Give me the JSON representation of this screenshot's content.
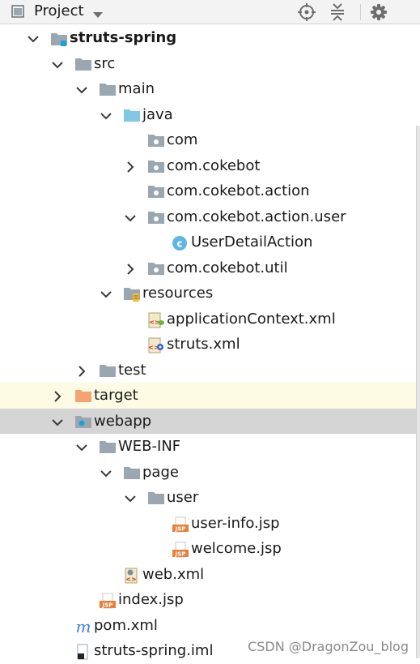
{
  "header": {
    "title": "Project",
    "icons": [
      "project-view-icon",
      "chevron-down-icon",
      "locate-icon",
      "collapse-all-icon",
      "gear-icon"
    ]
  },
  "tree": [
    {
      "label": "struts-spring",
      "depth": 0,
      "expanded": true,
      "icon": "module-folder-icon",
      "bold": true
    },
    {
      "label": "src",
      "depth": 1,
      "expanded": true,
      "icon": "folder-icon"
    },
    {
      "label": "main",
      "depth": 2,
      "expanded": true,
      "icon": "folder-icon"
    },
    {
      "label": "java",
      "depth": 3,
      "expanded": true,
      "icon": "source-root-folder-icon"
    },
    {
      "label": "com",
      "depth": 4,
      "icon": "package-icon"
    },
    {
      "label": "com.cokebot",
      "depth": 4,
      "expanded": false,
      "icon": "package-icon"
    },
    {
      "label": "com.cokebot.action",
      "depth": 4,
      "icon": "package-icon"
    },
    {
      "label": "com.cokebot.action.user",
      "depth": 4,
      "expanded": true,
      "icon": "package-icon"
    },
    {
      "label": "UserDetailAction",
      "depth": 5,
      "icon": "java-class-icon"
    },
    {
      "label": "com.cokebot.util",
      "depth": 4,
      "expanded": false,
      "icon": "package-icon"
    },
    {
      "label": "resources",
      "depth": 3,
      "expanded": true,
      "icon": "resources-folder-icon"
    },
    {
      "label": "applicationContext.xml",
      "depth": 4,
      "icon": "spring-xml-icon"
    },
    {
      "label": "struts.xml",
      "depth": 4,
      "icon": "struts-xml-icon"
    },
    {
      "label": "test",
      "depth": 2,
      "expanded": false,
      "icon": "folder-icon"
    },
    {
      "label": "target",
      "depth": 1,
      "expanded": false,
      "icon": "excluded-folder-icon",
      "highlight": "yellow"
    },
    {
      "label": "webapp",
      "depth": 1,
      "expanded": true,
      "icon": "web-folder-icon",
      "highlight": "grey"
    },
    {
      "label": "WEB-INF",
      "depth": 2,
      "expanded": true,
      "icon": "folder-icon"
    },
    {
      "label": "page",
      "depth": 3,
      "expanded": true,
      "icon": "folder-icon"
    },
    {
      "label": "user",
      "depth": 4,
      "expanded": true,
      "icon": "folder-icon"
    },
    {
      "label": "user-info.jsp",
      "depth": 5,
      "icon": "jsp-file-icon"
    },
    {
      "label": "welcome.jsp",
      "depth": 5,
      "icon": "jsp-file-icon"
    },
    {
      "label": "web.xml",
      "depth": 3,
      "icon": "web-xml-icon"
    },
    {
      "label": "index.jsp",
      "depth": 2,
      "icon": "jsp-file-icon"
    },
    {
      "label": "pom.xml",
      "depth": 1,
      "icon": "maven-icon"
    },
    {
      "label": "struts-spring.iml",
      "depth": 1,
      "icon": "iml-file-icon"
    }
  ],
  "watermark": "CSDN @DragonZou_blog"
}
